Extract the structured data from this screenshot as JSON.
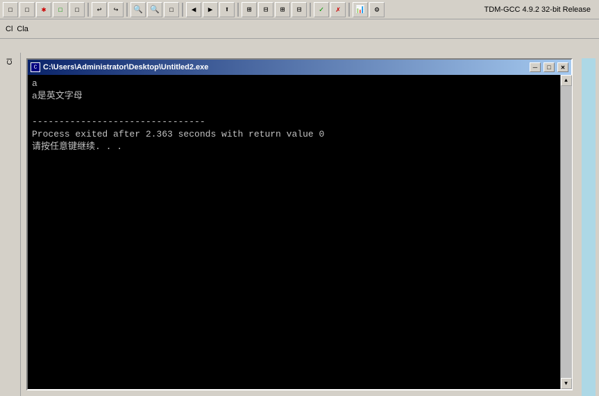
{
  "toolbar1": {
    "buttons": [
      "☐",
      "☐",
      "✱",
      "☐",
      "☐",
      "→",
      "←",
      "☐",
      "☐",
      "☐",
      "☐",
      "☐",
      "☐",
      "☐",
      "☐",
      "☐",
      "✓",
      "✗",
      "☐",
      "☐"
    ],
    "right_label": "TDM-GCC 4.9.2 32-bit Release"
  },
  "toolbar2": {
    "labels": [
      "Cla"
    ]
  },
  "console": {
    "title": "C:\\Users\\Administrator\\Desktop\\Untitled2.exe",
    "ctrl_min": "─",
    "ctrl_max": "□",
    "ctrl_close": "✕",
    "lines": [
      "a",
      "a是英文字母",
      "",
      "--------------------------------",
      "Process exited after 2.363 seconds with return value 0",
      "请按任意键继续. . ."
    ]
  },
  "right_panel": {
    "color": "#add8e6"
  }
}
